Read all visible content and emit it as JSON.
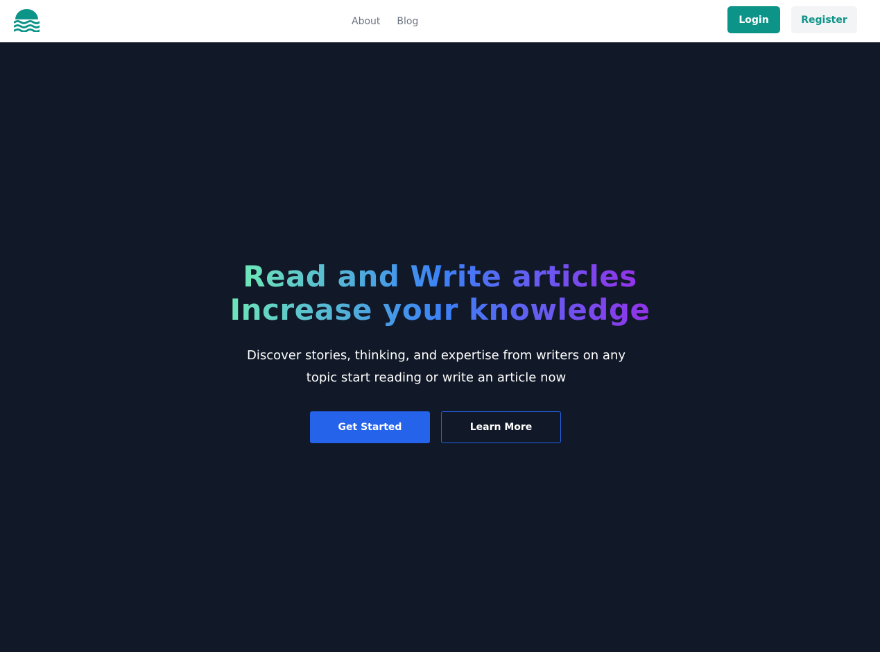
{
  "header": {
    "logo_icon": "waves-icon",
    "nav": [
      {
        "label": "About"
      },
      {
        "label": "Blog"
      }
    ],
    "login_label": "Login",
    "register_label": "Register"
  },
  "hero": {
    "headline_line1": "Read and Write articles",
    "headline_line2": "Increase your knowledge",
    "subtitle": "Discover stories, thinking, and expertise from writers on any topic start reading or write an article now",
    "primary_cta": "Get Started",
    "secondary_cta": "Learn More"
  },
  "colors": {
    "brand": "#0d9488",
    "background": "#111827",
    "primary_button": "#2563eb",
    "gradient_start": "#6ee7b7",
    "gradient_mid": "#3b82f6",
    "gradient_end": "#9333ea"
  }
}
